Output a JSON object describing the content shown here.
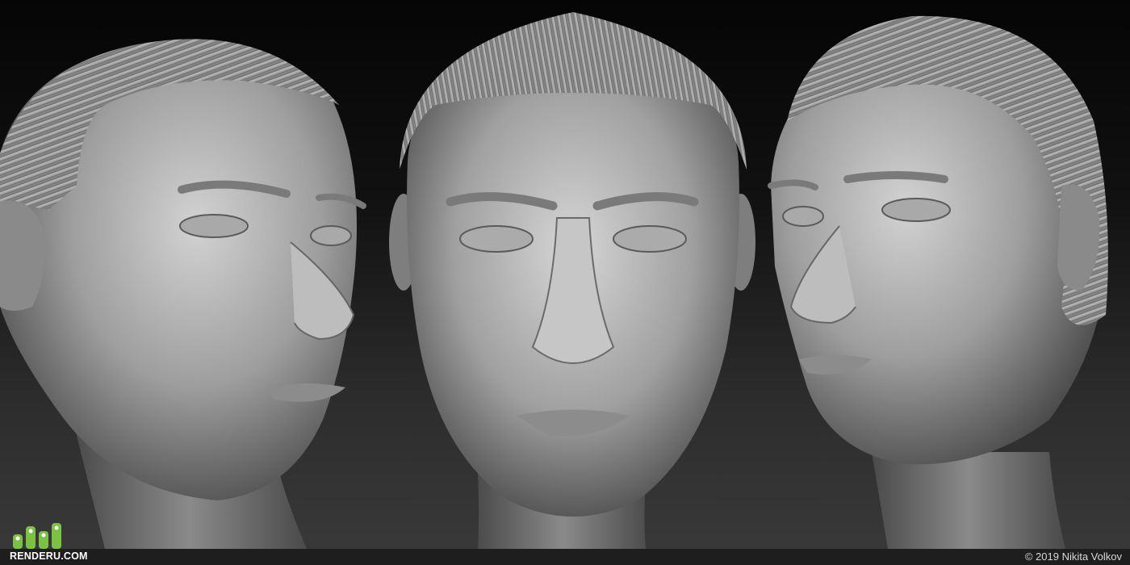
{
  "scene": {
    "views": [
      "three-quarter-left",
      "front",
      "three-quarter-right"
    ],
    "material_color": "#9a9a9a",
    "background_top": "#050505",
    "background_bottom": "#3a3a3a"
  },
  "watermark": {
    "logo_text": "RENDERU.COM",
    "logo_color": "#7cc242",
    "copyright": "© 2019 Nikita Volkov"
  }
}
